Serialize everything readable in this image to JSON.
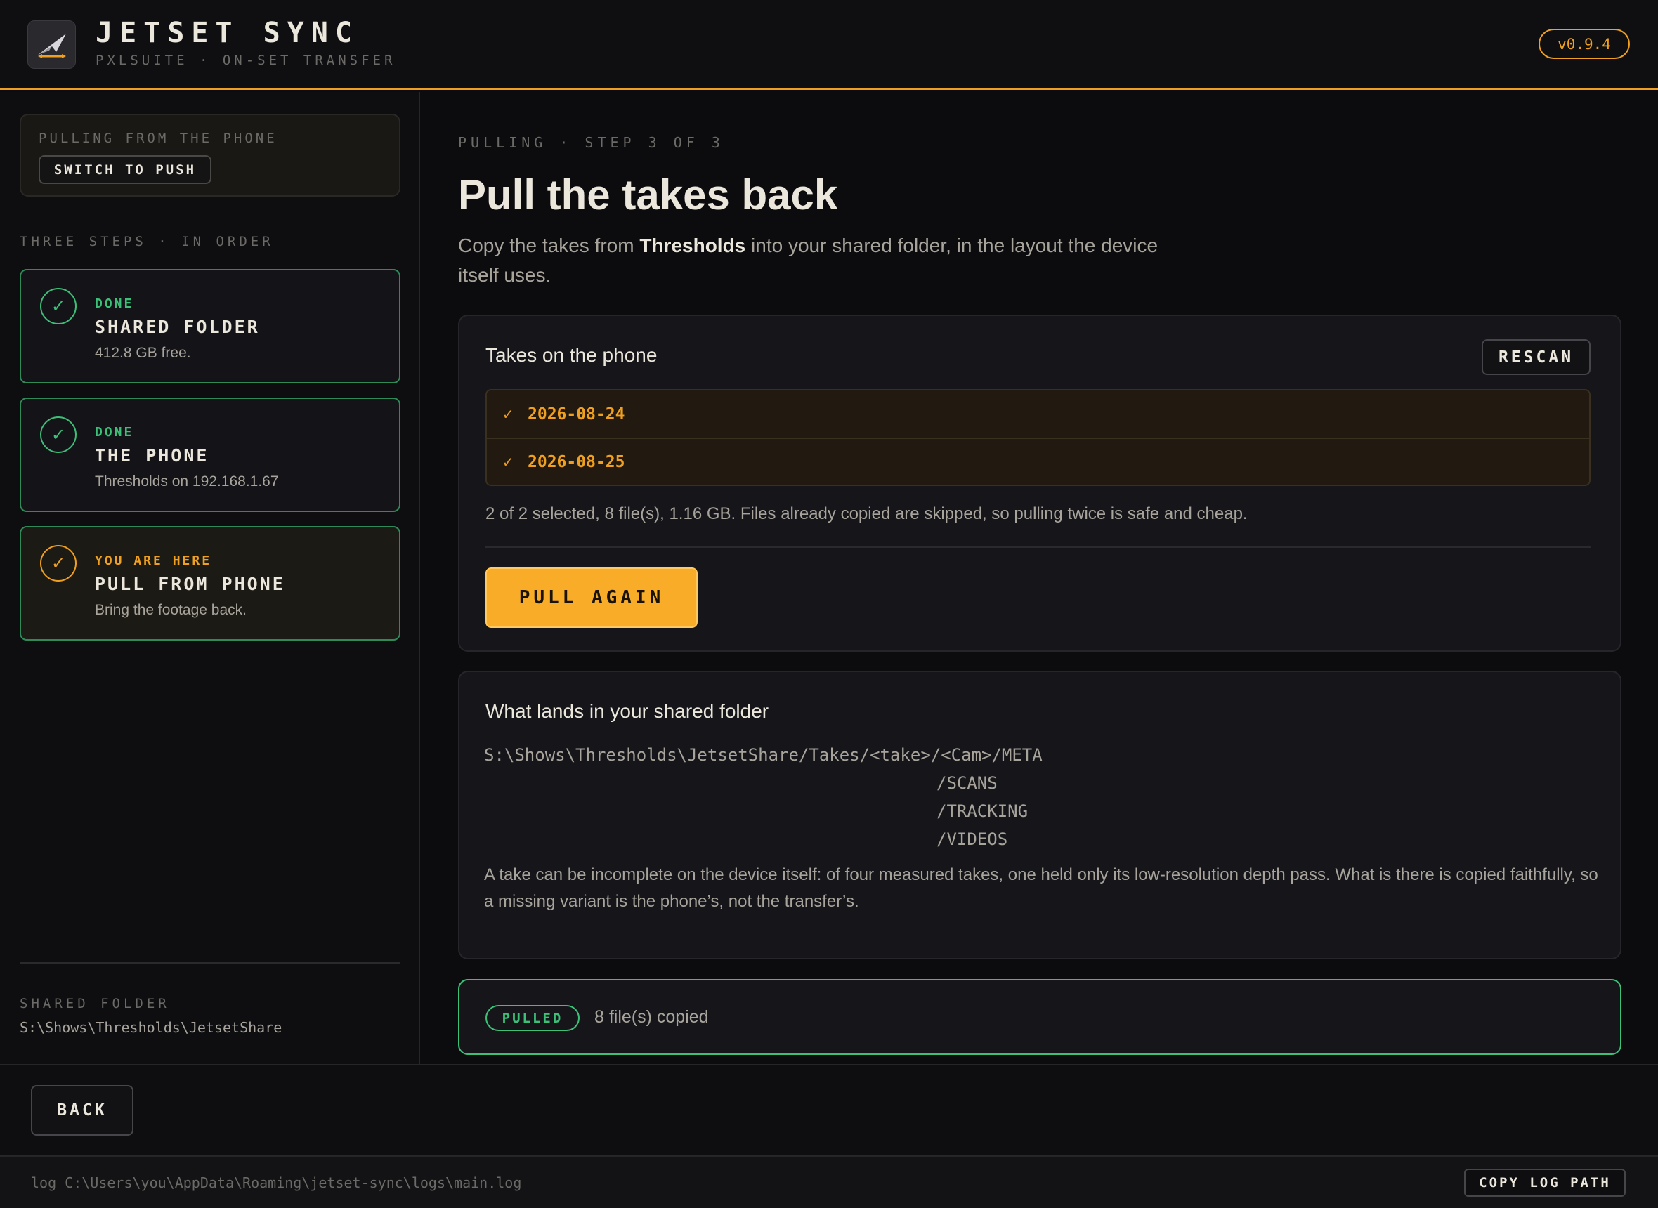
{
  "header": {
    "title": "JETSET SYNC",
    "subtitle": "PXLSUITE · ON-SET TRANSFER",
    "version": "v0.9.4",
    "logo_icon": "jet-plane-logo-icon"
  },
  "sidebar": {
    "mode_label": "PULLING FROM THE PHONE",
    "switch_label": "SWITCH TO PUSH",
    "steps_heading": "THREE STEPS · IN ORDER",
    "steps": [
      {
        "status": "DONE",
        "title": "SHARED FOLDER",
        "desc": "412.8 GB free.",
        "check": "✓"
      },
      {
        "status": "DONE",
        "title": "THE PHONE",
        "desc": "Thresholds on 192.168.1.67",
        "check": "✓"
      },
      {
        "status": "YOU ARE HERE",
        "title": "PULL FROM PHONE",
        "desc": "Bring the footage back.",
        "check": "✓"
      }
    ],
    "shared_folder_label": "SHARED FOLDER",
    "shared_folder_path": "S:\\Shows\\Thresholds\\JetsetShare"
  },
  "main": {
    "eyebrow": "PULLING · STEP 3 OF 3",
    "title": "Pull the takes back",
    "desc_before": "Copy the takes from ",
    "desc_bold": "Thresholds",
    "desc_after": " into your shared folder, in the layout the device itself uses.",
    "takes_card": {
      "title": "Takes on the phone",
      "rescan_label": "RESCAN",
      "takes": [
        {
          "check": "✓",
          "date": "2026-08-24"
        },
        {
          "check": "✓",
          "date": "2026-08-25"
        }
      ],
      "summary": "2 of 2 selected, 8 file(s), 1.16 GB. Files already copied are skipped, so pulling twice is safe and cheap.",
      "pull_label": "PULL AGAIN"
    },
    "folder_card": {
      "title": "What lands in your shared folder",
      "path_root": "S:\\Shows\\Thresholds\\JetsetShare/Takes/<take>/<Cam>/META",
      "path_subs": [
        "/SCANS",
        "/TRACKING",
        "/VIDEOS"
      ],
      "note": "A take can be incomplete on the device itself: of four measured takes, one held only its low-resolution depth pass. What is there is copied faithfully, so a missing variant is the phone’s, not the transfer’s."
    },
    "result": {
      "badge": "PULLED",
      "text": "8 file(s) copied"
    }
  },
  "footer": {
    "back_label": "BACK",
    "log_path": "log C:\\Users\\you\\AppData\\Roaming\\jetset-sync\\logs\\main.log",
    "copy_log_label": "COPY LOG PATH"
  },
  "colors": {
    "accent": "#f0a020",
    "success": "#3cc078",
    "background": "#0c0c0e"
  }
}
